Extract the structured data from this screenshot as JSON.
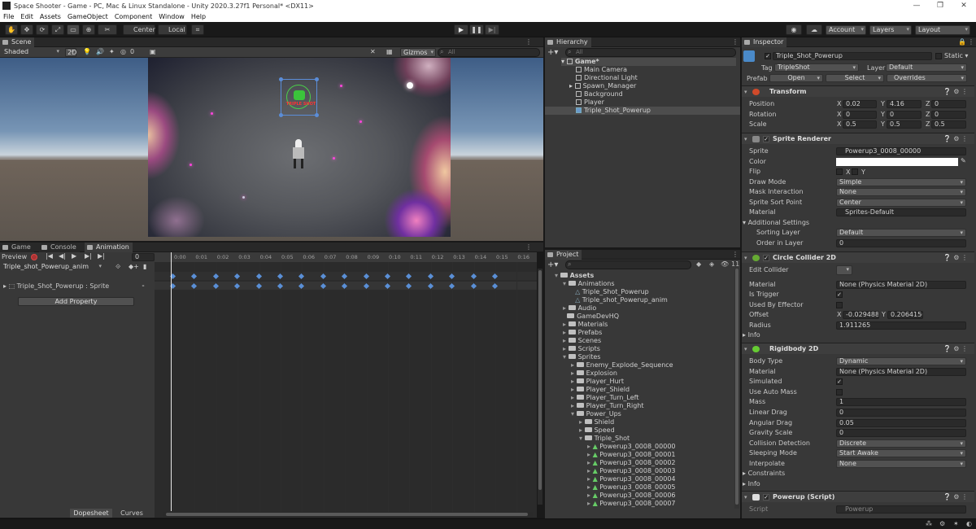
{
  "window": {
    "title": "Space Shooter - Game - PC, Mac & Linux Standalone - Unity 2020.3.27f1 Personal* <DX11>",
    "minimize": "—",
    "maximize": "❐",
    "close": "✕"
  },
  "menu": [
    "File",
    "Edit",
    "Assets",
    "GameObject",
    "Component",
    "Window",
    "Help"
  ],
  "toolbar": {
    "pivot": "Center",
    "space": "Local",
    "account": "Account",
    "layers": "Layers",
    "layout": "Layout"
  },
  "scene_panel": {
    "tab": "Scene",
    "shading": "Shaded",
    "mode_2d": "2D",
    "fx_count": "0",
    "gizmos": "Gizmos",
    "search_placeholder": "All",
    "powerup_text": "TRIPLE SHOT"
  },
  "hierarchy": {
    "tab": "Hierarchy",
    "search_placeholder": "All",
    "root": "Game*",
    "items": [
      "Main Camera",
      "Directional Light",
      "Spawn_Manager",
      "Background",
      "Player",
      "Triple_Shot_Powerup"
    ]
  },
  "project": {
    "tab": "Project",
    "badge": "11",
    "tree": [
      {
        "label": "Assets",
        "depth": 0,
        "open": true,
        "kind": "folder"
      },
      {
        "label": "Animations",
        "depth": 1,
        "open": true,
        "kind": "folder"
      },
      {
        "label": "Triple_Shot_Powerup",
        "depth": 2,
        "kind": "anim"
      },
      {
        "label": "Triple_shot_Powerup_anim",
        "depth": 2,
        "kind": "anim"
      },
      {
        "label": "Audio",
        "depth": 1,
        "kind": "folder"
      },
      {
        "label": "GameDevHQ",
        "depth": 1,
        "kind": "folder",
        "noarrow": true
      },
      {
        "label": "Materials",
        "depth": 1,
        "kind": "folder"
      },
      {
        "label": "Prefabs",
        "depth": 1,
        "kind": "folder"
      },
      {
        "label": "Scenes",
        "depth": 1,
        "kind": "folder"
      },
      {
        "label": "Scripts",
        "depth": 1,
        "kind": "folder"
      },
      {
        "label": "Sprites",
        "depth": 1,
        "open": true,
        "kind": "folder"
      },
      {
        "label": "Enemy_Explode_Sequence",
        "depth": 2,
        "kind": "folder"
      },
      {
        "label": "Explosion",
        "depth": 2,
        "kind": "folder"
      },
      {
        "label": "Player_Hurt",
        "depth": 2,
        "kind": "folder"
      },
      {
        "label": "Player_Shield",
        "depth": 2,
        "kind": "folder"
      },
      {
        "label": "Player_Turn_Left",
        "depth": 2,
        "kind": "folder"
      },
      {
        "label": "Player_Turn_Right",
        "depth": 2,
        "kind": "folder"
      },
      {
        "label": "Power_Ups",
        "depth": 2,
        "open": true,
        "kind": "folder"
      },
      {
        "label": "Shield",
        "depth": 3,
        "kind": "folder"
      },
      {
        "label": "Speed",
        "depth": 3,
        "kind": "folder"
      },
      {
        "label": "Triple_Shot",
        "depth": 3,
        "open": true,
        "kind": "folder"
      },
      {
        "label": "Powerup3_0008_00000",
        "depth": 4,
        "kind": "sprite"
      },
      {
        "label": "Powerup3_0008_00001",
        "depth": 4,
        "kind": "sprite"
      },
      {
        "label": "Powerup3_0008_00002",
        "depth": 4,
        "kind": "sprite"
      },
      {
        "label": "Powerup3_0008_00003",
        "depth": 4,
        "kind": "sprite"
      },
      {
        "label": "Powerup3_0008_00004",
        "depth": 4,
        "kind": "sprite"
      },
      {
        "label": "Powerup3_0008_00005",
        "depth": 4,
        "kind": "sprite"
      },
      {
        "label": "Powerup3_0008_00006",
        "depth": 4,
        "kind": "sprite"
      },
      {
        "label": "Powerup3_0008_00007",
        "depth": 4,
        "kind": "sprite"
      }
    ]
  },
  "bottom_tabs": {
    "game": "Game",
    "console": "Console",
    "animation": "Animation"
  },
  "animation": {
    "preview": "Preview",
    "frame": "0",
    "clip": "Triple_shot_Powerup_anim",
    "property": "Triple_Shot_Powerup : Sprite",
    "add_property": "Add Property",
    "dopesheet": "Dopesheet",
    "curves": "Curves",
    "ticks": [
      "0:00",
      "0:01",
      "0:02",
      "0:03",
      "0:04",
      "0:05",
      "0:06",
      "0:07",
      "0:08",
      "0:09",
      "0:10",
      "0:11",
      "0:12",
      "0:13",
      "0:14",
      "0:15",
      "0:16"
    ]
  },
  "inspector": {
    "tab": "Inspector",
    "object_name": "Triple_Shot_Powerup",
    "static_label": "Static",
    "tag_label": "Tag",
    "tag": "TripleShot",
    "layer_label": "Layer",
    "layer": "Default",
    "prefab_label": "Prefab",
    "prefab_open": "Open",
    "prefab_select": "Select",
    "prefab_overrides": "Overrides",
    "transform": {
      "title": "Transform",
      "position_label": "Position",
      "rotation_label": "Rotation",
      "scale_label": "Scale",
      "position": [
        "0.02",
        "4.16",
        "0"
      ],
      "rotation": [
        "0",
        "0",
        "0"
      ],
      "scale": [
        "0.5",
        "0.5",
        "0.5"
      ]
    },
    "sprite_renderer": {
      "title": "Sprite Renderer",
      "sprite_label": "Sprite",
      "sprite": "Powerup3_0008_00000",
      "color_label": "Color",
      "flip_label": "Flip",
      "flip_x": "X",
      "flip_y": "Y",
      "draw_mode_label": "Draw Mode",
      "draw_mode": "Simple",
      "mask_label": "Mask Interaction",
      "mask": "None",
      "sort_point_label": "Sprite Sort Point",
      "sort_point": "Center",
      "material_label": "Material",
      "material": "Sprites-Default",
      "additional_label": "Additional Settings",
      "sorting_layer_label": "Sorting Layer",
      "sorting_layer": "Default",
      "order_label": "Order in Layer",
      "order": "0"
    },
    "circle_collider": {
      "title": "Circle Collider 2D",
      "edit_label": "Edit Collider",
      "material_label": "Material",
      "material": "None (Physics Material 2D)",
      "trigger_label": "Is Trigger",
      "effector_label": "Used By Effector",
      "offset_label": "Offset",
      "offset_x": "-0.029488(",
      "offset_y": "0.2064156",
      "radius_label": "Radius",
      "radius": "1.911265",
      "info_label": "Info"
    },
    "rigidbody": {
      "title": "Rigidbody 2D",
      "body_type_label": "Body Type",
      "body_type": "Dynamic",
      "material_label": "Material",
      "material": "None (Physics Material 2D)",
      "simulated_label": "Simulated",
      "auto_mass_label": "Use Auto Mass",
      "mass_label": "Mass",
      "mass": "1",
      "linear_drag_label": "Linear Drag",
      "linear_drag": "0",
      "angular_drag_label": "Angular Drag",
      "angular_drag": "0.05",
      "gravity_label": "Gravity Scale",
      "gravity": "0",
      "collision_label": "Collision Detection",
      "collision": "Discrete",
      "sleeping_label": "Sleeping Mode",
      "sleeping": "Start Awake",
      "interpolate_label": "Interpolate",
      "interpolate": "None",
      "constraints_label": "Constraints",
      "info_label": "Info"
    },
    "powerup_script": {
      "title": "Powerup (Script)",
      "script_label": "Script",
      "script": "Powerup"
    }
  }
}
